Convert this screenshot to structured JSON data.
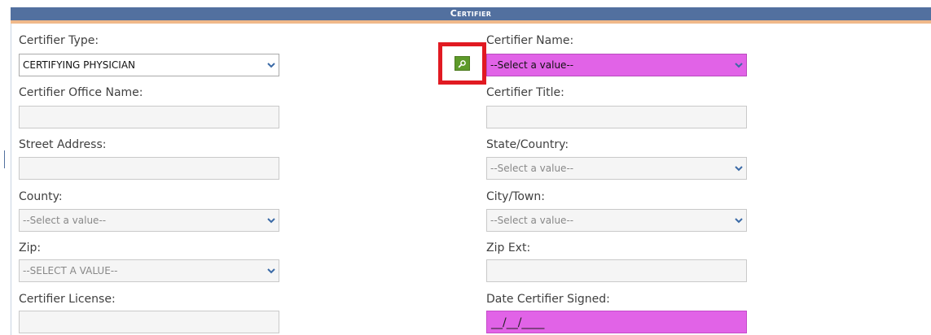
{
  "section": {
    "title_first": "C",
    "title_rest": "ERTIFIER"
  },
  "fields": {
    "certifier_type": {
      "label": "Certifier Type:",
      "value": "CERTIFYING PHYSICIAN"
    },
    "certifier_name": {
      "label": "Certifier Name:",
      "value": "--Select a value--"
    },
    "certifier_office_name": {
      "label": "Certifier Office Name:",
      "value": ""
    },
    "certifier_title": {
      "label": "Certifier Title:",
      "value": ""
    },
    "street_address": {
      "label": "Street Address:",
      "value": ""
    },
    "state_country": {
      "label": "State/Country:",
      "value": "--Select a value--"
    },
    "county": {
      "label": "County:",
      "value": "--Select a value--"
    },
    "city_town": {
      "label": "City/Town:",
      "value": "--Select a value--"
    },
    "zip": {
      "label": "Zip:",
      "value": "--SELECT A VALUE--"
    },
    "zip_ext": {
      "label": "Zip Ext:",
      "value": ""
    },
    "certifier_license": {
      "label": "Certifier License:",
      "value": ""
    },
    "date_certifier_signed": {
      "label": "Date Certifier Signed:",
      "value": "__/__/____"
    }
  },
  "icons": {
    "lookup": "search-icon",
    "dropdown": "chevron-down-icon"
  },
  "colors": {
    "header_bg": "#52709f",
    "header_accent": "#f0b98a",
    "required_field": "#e163e7",
    "highlight_box": "#e11a22",
    "lookup_button": "#5d9a2a"
  }
}
